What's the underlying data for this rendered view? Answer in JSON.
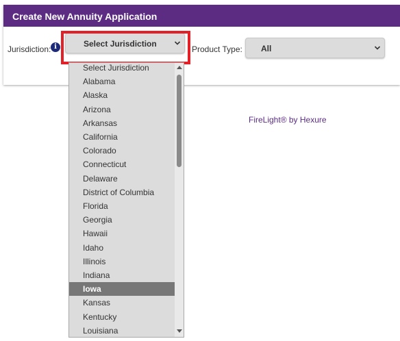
{
  "header": {
    "title": "Create New Annuity Application"
  },
  "jurisdiction": {
    "label": "Jurisdiction:",
    "selected": "Select Jurisdiction",
    "options": [
      "Select Jurisdiction",
      "Alabama",
      "Alaska",
      "Arizona",
      "Arkansas",
      "California",
      "Colorado",
      "Connecticut",
      "Delaware",
      "District of Columbia",
      "Florida",
      "Georgia",
      "Hawaii",
      "Idaho",
      "Illinois",
      "Indiana",
      "Iowa",
      "Kansas",
      "Kentucky",
      "Louisiana"
    ],
    "highlighted": "Iowa"
  },
  "product_type": {
    "label": "Product Type:",
    "selected": "All"
  },
  "footer": {
    "brand": "FireLight® by Hexure"
  },
  "colors": {
    "header_bg": "#5b2c82",
    "highlight_border": "#e22027",
    "selected_option_bg": "#777777",
    "info_icon": "#1c2a78"
  },
  "icons": {
    "info": "info-circle-icon",
    "chevron": "chevron-down-icon",
    "scroll_up": "scroll-up-arrow-icon",
    "scroll_down": "scroll-down-arrow-icon"
  }
}
